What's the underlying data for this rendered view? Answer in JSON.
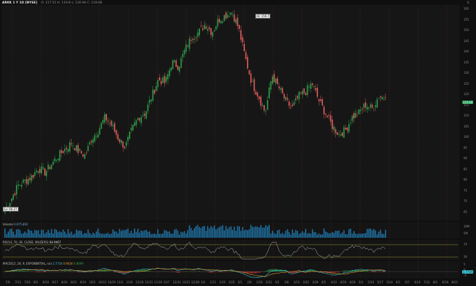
{
  "header": {
    "symbol": "ARKK 1 Y 1D [NYSE]",
    "ohlc": "O: 117.51  H: 119.8  L: 116.94  C: 119.08",
    "corner_button": "Q"
  },
  "price_axis": {
    "ticks": [
      "160",
      "155",
      "150",
      "145",
      "140",
      "135",
      "130",
      "125",
      "120",
      "115",
      "110",
      "105",
      "100",
      "95",
      "90",
      "85",
      "80",
      "75",
      "70",
      "65"
    ],
    "last_price": "119.08",
    "last_price_color": "#1f9d55"
  },
  "markers": {
    "high": "Hi: 159.7",
    "low": "Lo: 66.27"
  },
  "volume_pane": {
    "label": "Volume",
    "value": "6,975,892",
    "ticks": [
      "10M",
      "5M"
    ]
  },
  "rsi_pane": {
    "label": "RSI(14, 70, 30, CLOSE, WILDERS)",
    "value": "64.9467",
    "ticks": [
      "70",
      "30"
    ]
  },
  "macd_pane": {
    "label": "MACD(12, 26, 9, EXPONENTIAL, no)",
    "values": [
      "1.7734",
      "0.9034",
      "0.8699"
    ],
    "ticks": [
      "5",
      "0",
      "-5"
    ],
    "chip": "1.7734"
  },
  "time_axis": [
    "7/6",
    "7/13",
    "7/20",
    "8/3",
    "8/10",
    "8/17",
    "8/24",
    "8/31",
    "9/14",
    "10/5",
    "10/12",
    "10/19",
    "11/2",
    "11/9",
    "11/16",
    "11/23",
    "11/30",
    "12/7",
    "12/14",
    "12/21",
    "12/28",
    "1/4",
    "1/11",
    "1/19",
    "1/25",
    "2/1",
    "2/8",
    "2/16",
    "2/22",
    "3/1",
    "3/8",
    "3/15",
    "3/22",
    "3/29",
    "4/5",
    "4/12",
    "4/19",
    "4/26",
    "5/3",
    "5/10",
    "5/17",
    "5/24",
    "6/1",
    "6/7",
    "6/14",
    "7/12",
    "8/2",
    "8/16",
    "8/23"
  ],
  "chart_data": {
    "type": "candlestick",
    "title": "ARKK 1 Y 1D [NYSE]",
    "ylim": [
      62,
      162
    ],
    "x": [
      "Jul 2020",
      "Aug 2020",
      "Sep 2020",
      "Oct 2020",
      "Nov 2020",
      "Dec 2020",
      "Jan 2021",
      "Feb 2021",
      "Mar 2021",
      "Apr 2021",
      "May 2021",
      "Jun 2021"
    ],
    "close_path": [
      66.3,
      72,
      78,
      80,
      82,
      86,
      84,
      88,
      92,
      95,
      98,
      94,
      92,
      100,
      104,
      110,
      106,
      100,
      96,
      104,
      110,
      112,
      120,
      128,
      126,
      136,
      134,
      142,
      148,
      150,
      154,
      150,
      156,
      158,
      159.7,
      152,
      138,
      126,
      120,
      112,
      130,
      124,
      118,
      114,
      120,
      122,
      126,
      118,
      112,
      106,
      102,
      104,
      110,
      112,
      116,
      114,
      120,
      119.08
    ],
    "up_color": "#2e9e4a",
    "down_color": "#e25c5c",
    "grid": "vertical dashed red",
    "volume_color": "#1e6fa0",
    "rsi_color": "#bdbdbd",
    "macd_colors": {
      "macd": "#39c5d6",
      "signal": "#e0a030",
      "hist_pos": "#2e9e4a",
      "hist_neg": "#c73a3a"
    }
  }
}
